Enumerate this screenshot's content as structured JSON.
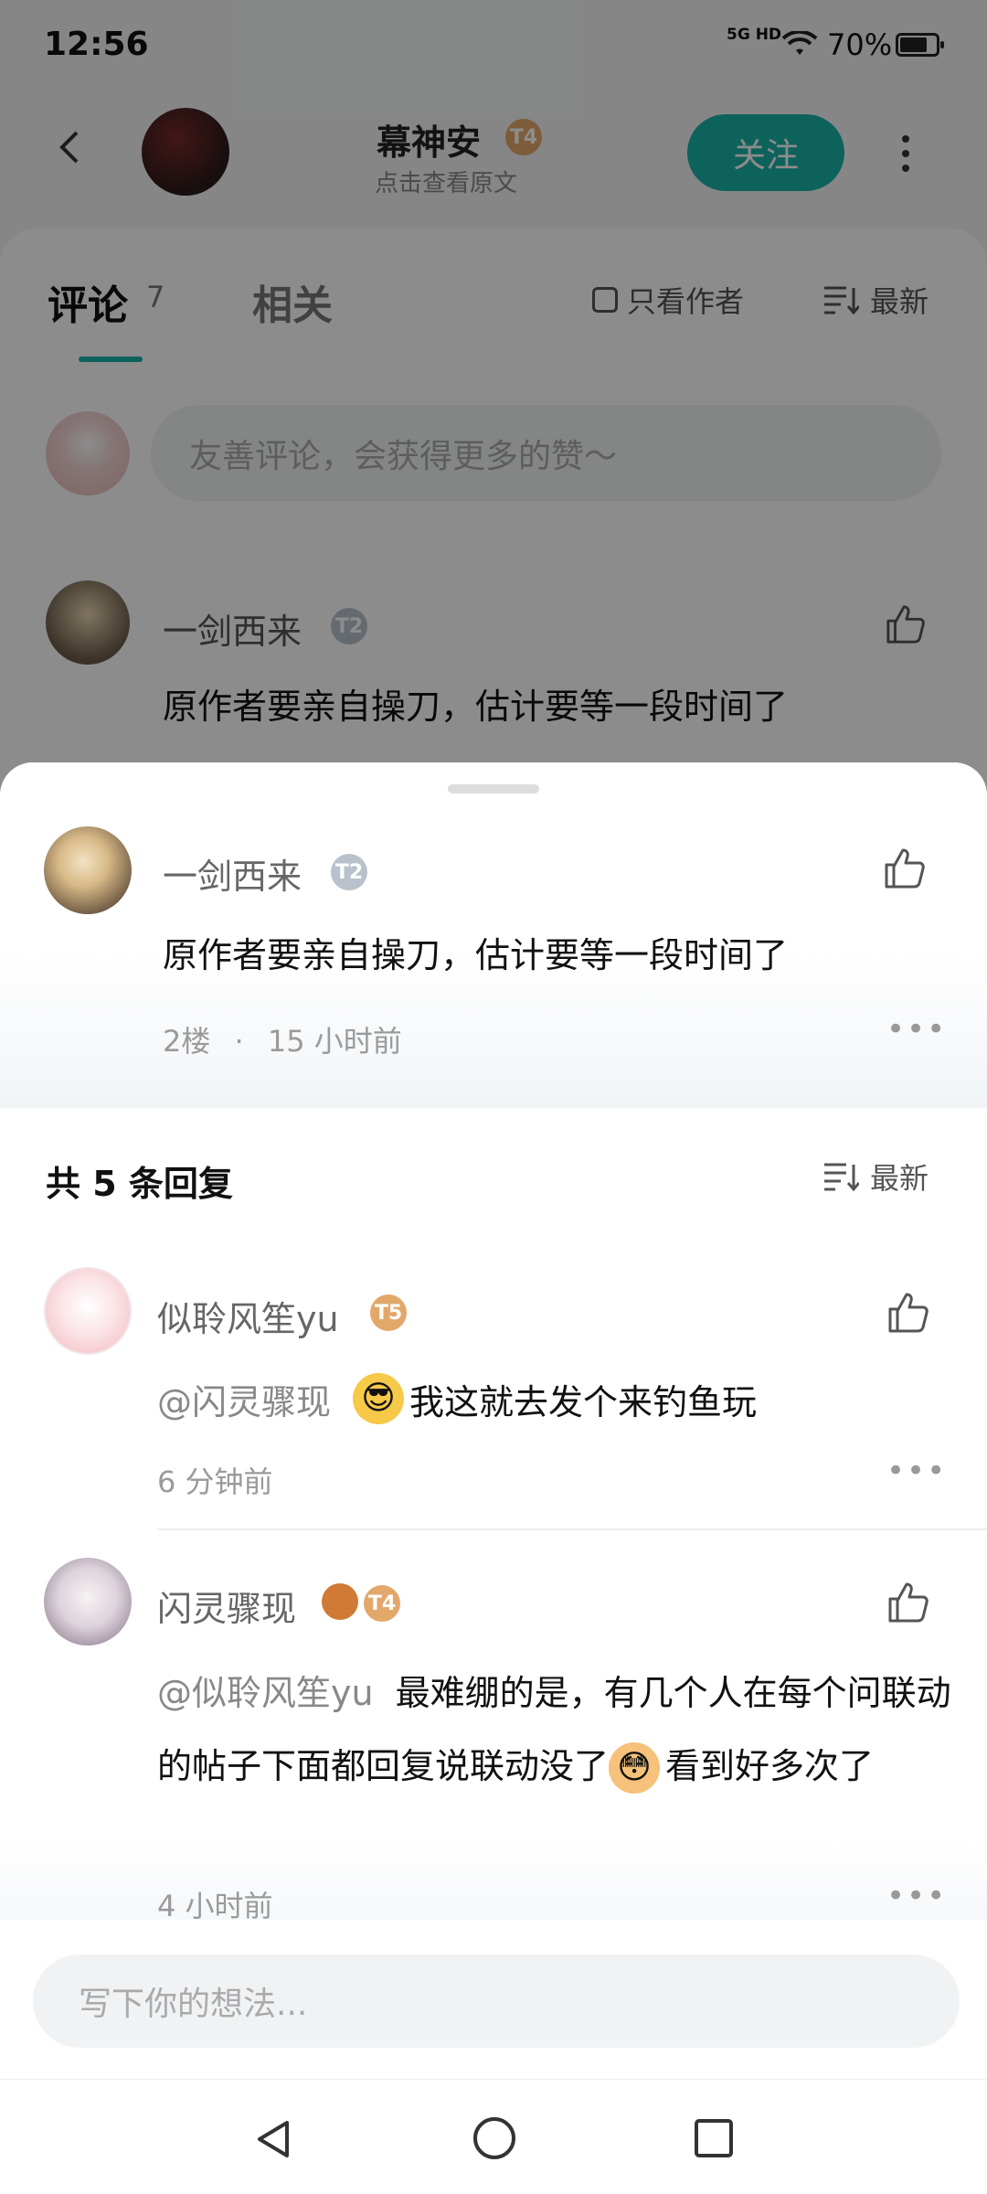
{
  "status_bar": {
    "time": "12:56",
    "network": "5G HD",
    "battery": "70%"
  },
  "header": {
    "author_name": "幕神安",
    "author_badge": "T4",
    "subtitle": "点击查看原文",
    "follow_label": "关注"
  },
  "tabs": {
    "comments_label": "评论",
    "comments_count": "7",
    "related_label": "相关",
    "only_author_label": "只看作者",
    "sort_label": "最新"
  },
  "comment_input": {
    "placeholder": "友善评论，会获得更多的赞～"
  },
  "background_comment": {
    "user": "一剑西来",
    "text": "原作者要亲自操刀，估计要等一段时间了"
  },
  "sheet": {
    "root_comment": {
      "user": "一剑西来",
      "badge": "T2",
      "text": "原作者要亲自操刀，估计要等一段时间了",
      "floor": "2楼",
      "separator": "·",
      "time": "15 小时前"
    },
    "replies_header": "共 5 条回复",
    "sort_label": "最新",
    "replies": [
      {
        "user": "似聆风笙yu",
        "badge": "T5",
        "mention": "@闪灵骤现",
        "emoji": "😎",
        "text": "我这就去发个来钓鱼玩",
        "time": "6 分钟前"
      },
      {
        "user": "闪灵骤现",
        "badge": "T4",
        "mention": "@似聆风笙yu",
        "text_part1": "最难绷的是，有几个人在每个问联动的帖子下面都回复说联动没了",
        "emoji": "😳",
        "text_part2": "看到好多次了",
        "time": "4 小时前"
      }
    ],
    "composer_placeholder": "写下你的想法..."
  },
  "colors": {
    "accent": "#1ab3a8",
    "badge_gold": "#e2a86a",
    "badge_silver": "#b9c2cc"
  }
}
